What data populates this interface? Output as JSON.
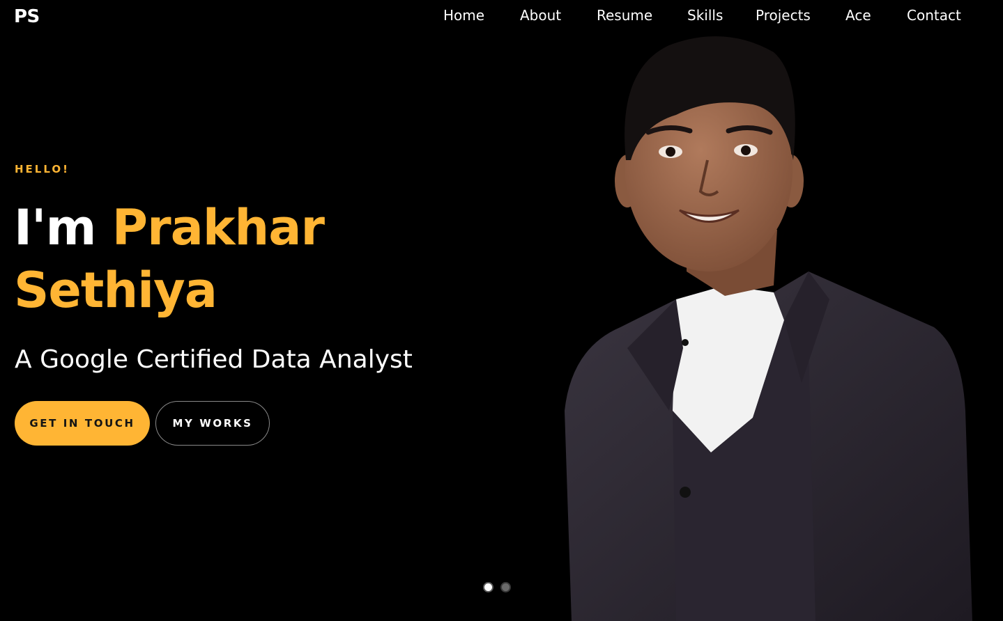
{
  "brand": {
    "logo": "PS"
  },
  "nav": {
    "items": [
      "Home",
      "About",
      "Resume",
      "Skills",
      "Projects",
      "Ace",
      "Contact"
    ]
  },
  "hero": {
    "greeting": "HELLO!",
    "headline_prefix": "I'm",
    "name_first": "Prakhar",
    "name_last": "Sethiya",
    "subtitle": "A Google Certified Data Analyst",
    "primary_button": "GET IN TOUCH",
    "secondary_button": "MY WORKS"
  },
  "carousel": {
    "slides": 2,
    "active_slide": 1
  },
  "colors": {
    "background": "#000000",
    "accent": "#ffb534",
    "text": "#ffffff"
  },
  "icons": {
    "portrait": "person-portrait-photo"
  }
}
